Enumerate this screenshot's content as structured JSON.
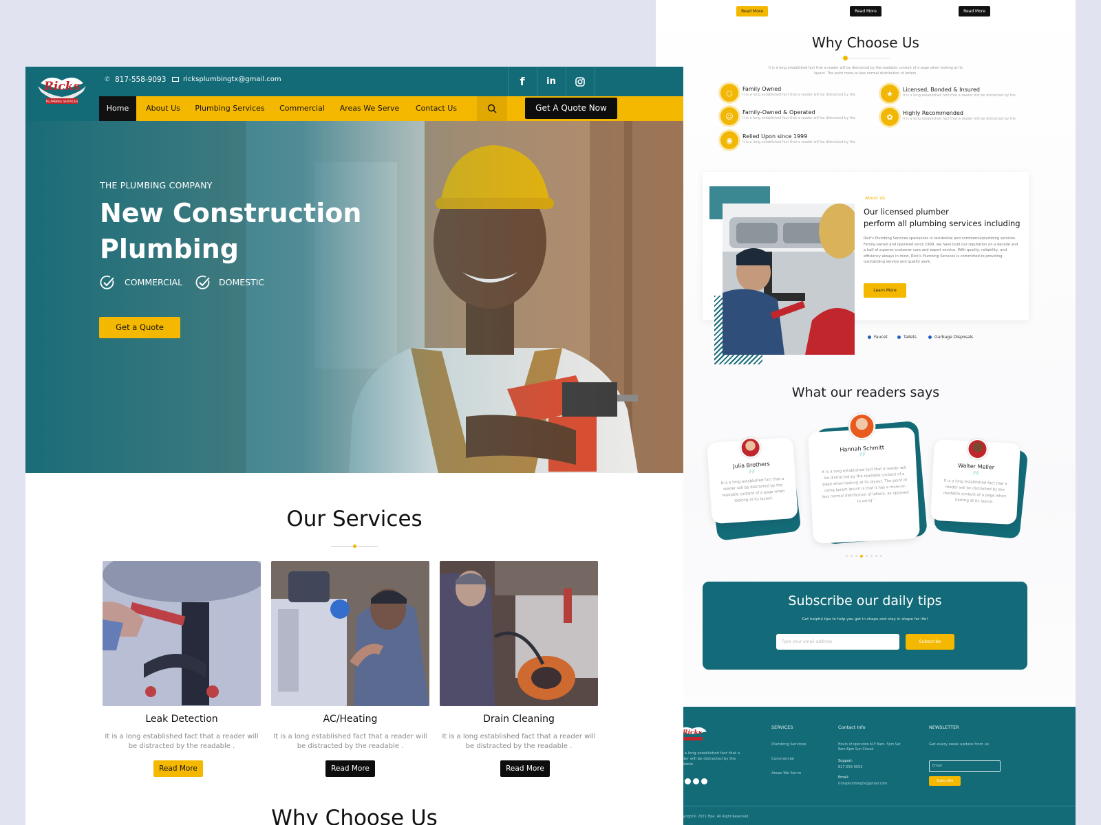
{
  "right": {
    "top_buttons": [
      "Read More",
      "Read More",
      "Read More"
    ],
    "why": {
      "title": "Why Choose Us",
      "intro": "It is a long established fact that a reader will be distracted by the readable content of a page when looking at its layout. The point  more-or-less normal distribution of letters.",
      "items": [
        {
          "title": "Family Owned",
          "desc": "It is a long established fact that a reader will be distracted by the",
          "icon": "swimmer-icon"
        },
        {
          "title": "Licensed, Bonded & Insured",
          "desc": "It is a long established fact that a reader will be distracted by the",
          "icon": "badge-icon"
        },
        {
          "title": "Family-Owned & Operated",
          "desc": "It is a long established fact that a reader will be distracted by the",
          "icon": "people-icon"
        },
        {
          "title": "Highly Recommended",
          "desc": "It is a long established fact that a reader will be distracted by the",
          "icon": "award-icon"
        },
        {
          "title": "Relied Upon since 1999",
          "desc": "It is a long established fact that a reader will be distracted by the",
          "icon": "bike-icon"
        }
      ]
    },
    "about": {
      "kicker": "About Us",
      "heading_line1": "Our licensed plumber",
      "heading_line2": "perform all plumbing services including",
      "body": "Rick's Plumbing Services specializes in residential and commercialplumbing services. Family-owned and operated since 1999, we have built our reputation on a decade and a half of superior customer care and expert service. With quality, reliability, and efficiency always in mind, Rick's Plumbing Services is committed to providing outstanding service and quality work.",
      "button": "Learn More",
      "tags": [
        "Faucet",
        "Tailets",
        "Garbage Disposals"
      ]
    },
    "testimonials": {
      "title": "What our readers says",
      "items": [
        {
          "name": "Julia Brothers",
          "text": "It is a long established fact that a reader will be distracted by the readable content of a page when looking at its layout."
        },
        {
          "name": "Hannah Schmitt",
          "text": "It is a long established fact that a reader will be distracted by the readable content of a page when looking at its layout. The point of using Lorem Ipsum is that it has a more-or-less normal distribution of letters, as opposed to using '"
        },
        {
          "name": "Walter Meller",
          "text": "It is a long established fact that a reader will be distracted by the readable content of a page when looking at its layout."
        }
      ]
    },
    "subscribe": {
      "title": "Subscribe our daily tips",
      "sub": "Get  helpful tips to help you get in shape and stay in shape for life!",
      "placeholder": "Type your email address",
      "button": "Subscribe"
    },
    "footer": {
      "about": "It is a long established fact that a reader will be distracted by the readable",
      "services_title": "SERVICES",
      "services": [
        "Plumbing Services",
        "Commercial",
        "Areas We Serve"
      ],
      "contact_title": "Contact Info",
      "hours": "Hours of operation M-F 8am- 5pm Sat 8am-6pm Sun Closed",
      "support_label": "Support:",
      "support_phone": "817-558-9093",
      "email_label": "Email:",
      "email": "ricksplumbingtx@gmail.com",
      "newsletter_title": "NEWSLETTER",
      "newsletter_text": "Get every week update from us",
      "email_placeholder": "Email",
      "subscribe": "Subscribe",
      "copyright": "Copyright© 2021 Fipe. All Right Reserved."
    }
  },
  "left": {
    "phone": "817-558-9093",
    "email": "ricksplumbingtx@gmail.com",
    "nav": [
      "Home",
      "About Us",
      "Plumbing Services",
      "Commercial",
      "Areas We Serve",
      "Contact Us"
    ],
    "cta": "Get A Quote Now",
    "hero": {
      "kicker": "THE PLUMBING COMPANY",
      "title_line1": "New Construction",
      "title_line2": "Plumbing",
      "check1": "COMMERCIAL",
      "check2": "DOMESTIC",
      "button": "Get a Quote"
    },
    "services": {
      "title": "Our Services",
      "items": [
        {
          "title": "Leak Detection",
          "desc": "It is a long established fact that a reader will be distracted by the readable .",
          "button": "Read More"
        },
        {
          "title": "AC/Heating",
          "desc": "It is a long established fact that a reader will be distracted by the readable .",
          "button": "Read More"
        },
        {
          "title": "Drain Cleaning",
          "desc": "It is a long established fact that a reader will be distracted by the readable .",
          "button": "Read More"
        }
      ]
    },
    "next_title": "Why Choose Us"
  },
  "colors": {
    "teal": "#146b78",
    "yellow": "#f5b800",
    "black": "#111111"
  }
}
